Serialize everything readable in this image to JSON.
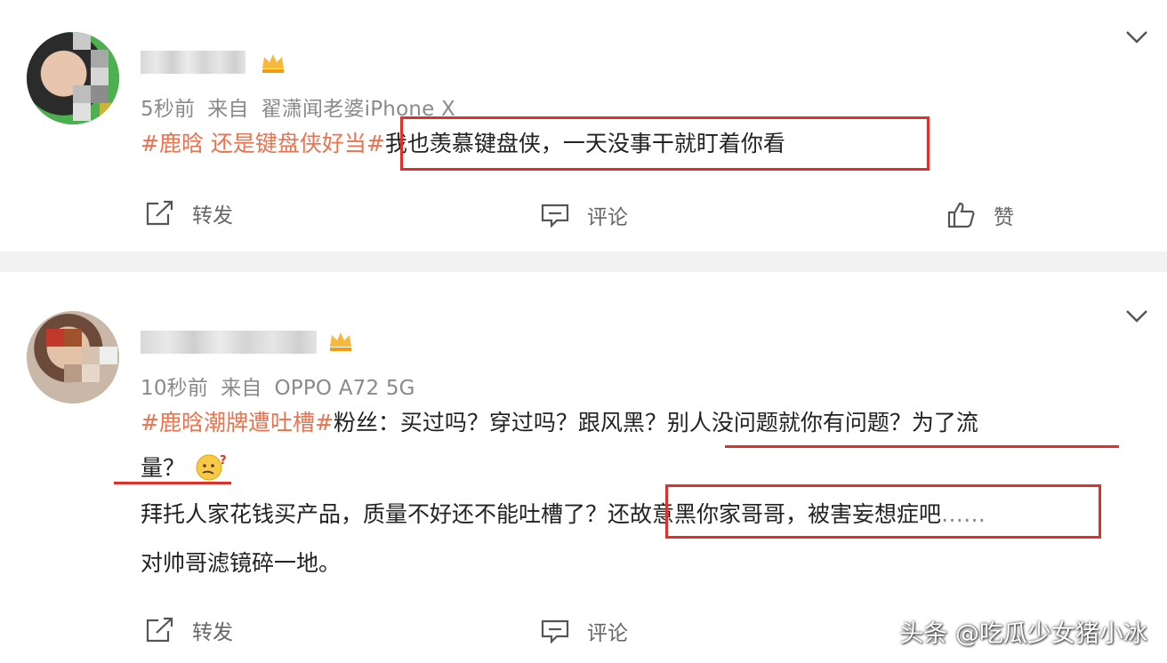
{
  "posts": [
    {
      "username": "",
      "time": "5秒前",
      "source_prefix": "来自",
      "source": "翟潇闻老婆iPhone X",
      "hashtag": "#鹿晗 还是键盘侠好当#",
      "boxed_text": "我也羡慕键盘侠，一天没事干就盯着你看",
      "actions": {
        "repost": "转发",
        "comment": "评论",
        "like": "赞"
      }
    },
    {
      "username": "",
      "time": "10秒前",
      "source_prefix": "来自",
      "source": "OPPO A72 5G",
      "hashtag": "#鹿晗潮牌遭吐槽#",
      "line1_text": "粉丝：买过吗？穿过吗？跟风黑？",
      "line1_underlined": "别人没问题就你有问题？为了流",
      "line2_text": "量？",
      "line3_text": "拜托人家花钱买产品，质量不好还不能吐槽了",
      "line3_boxed": "？还故意黑你家哥哥，被害妄想症吧",
      "line3_ellipsis": "……",
      "line4_text": "对帅哥滤镜碎一地。",
      "actions": {
        "repost": "转发",
        "comment": "评论"
      }
    }
  ],
  "watermark": "头条 @吃瓜少女猪小冰",
  "colors": {
    "hashtag": "#eb7350",
    "annotation_red": "#e0302a",
    "meta_gray": "#8a8a8a",
    "separator": "#f2f2f2"
  },
  "icons": [
    "chevron-down-icon",
    "repost-icon",
    "comment-icon",
    "like-icon",
    "vip-crown-icon",
    "confused-emoji-icon"
  ]
}
